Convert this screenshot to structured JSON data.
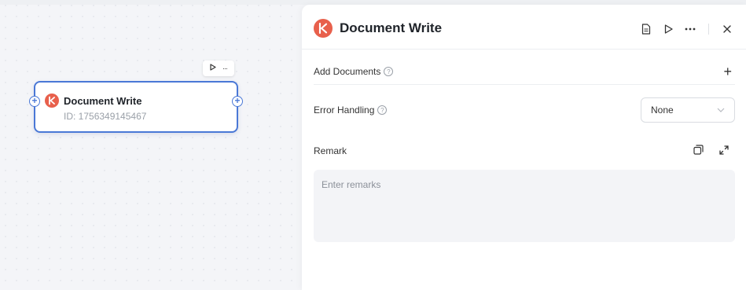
{
  "canvas": {
    "node": {
      "title": "Document Write",
      "id_text": "ID: 1756349145467",
      "toolbar": {
        "run_icon": "play-icon",
        "more_icon": "more-icon",
        "more_text": "···"
      }
    }
  },
  "panel": {
    "title": "Document Write",
    "header_icons": [
      "document-icon",
      "play-icon",
      "more-icon",
      "close-icon"
    ],
    "add_documents": {
      "label": "Add Documents",
      "help": "?",
      "add_symbol": "+"
    },
    "error_handling": {
      "label": "Error Handling",
      "help": "?",
      "selected": "None"
    },
    "remark": {
      "label": "Remark",
      "placeholder": "Enter remarks",
      "value": ""
    }
  },
  "colors": {
    "accent": "#4a78d6",
    "brand": "#e8604c"
  }
}
